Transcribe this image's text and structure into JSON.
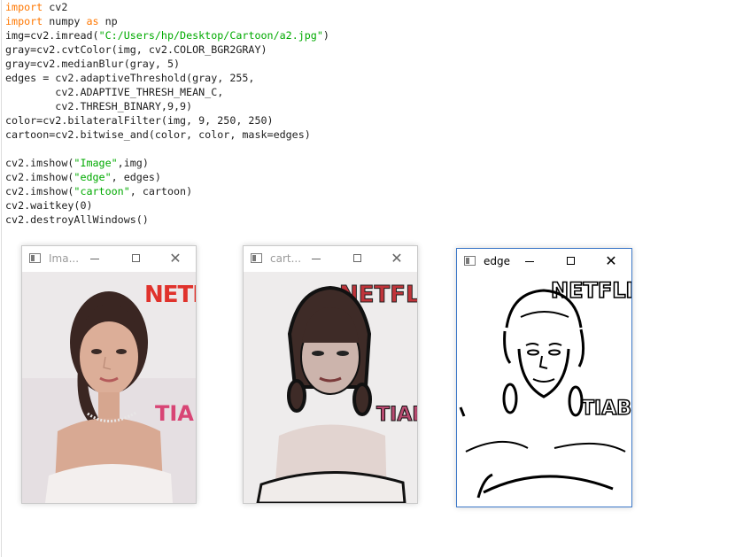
{
  "code": {
    "lines": [
      [
        {
          "t": "import",
          "c": "kw"
        },
        {
          "t": " cv2",
          "c": ""
        }
      ],
      [
        {
          "t": "import",
          "c": "kw"
        },
        {
          "t": " numpy ",
          "c": ""
        },
        {
          "t": "as",
          "c": "kw"
        },
        {
          "t": " np",
          "c": ""
        }
      ],
      [
        {
          "t": "img=cv2.imread(",
          "c": ""
        },
        {
          "t": "\"C:/Users/hp/Desktop/Cartoon/a2.jpg\"",
          "c": "str"
        },
        {
          "t": ")",
          "c": ""
        }
      ],
      [
        {
          "t": "gray=cv2.cvtColor(img, cv2.COLOR_BGR2GRAY)",
          "c": ""
        }
      ],
      [
        {
          "t": "gray=cv2.medianBlur(gray, 5)",
          "c": ""
        }
      ],
      [
        {
          "t": "edges = cv2.adaptiveThreshold(gray, 255,",
          "c": ""
        }
      ],
      [
        {
          "t": "        cv2.ADAPTIVE_THRESH_MEAN_C,",
          "c": ""
        }
      ],
      [
        {
          "t": "        cv2.THRESH_BINARY,9,9)",
          "c": ""
        }
      ],
      [
        {
          "t": "color=cv2.bilateralFilter(img, 9, 250, 250)",
          "c": ""
        }
      ],
      [
        {
          "t": "cartoon=cv2.bitwise_and(color, color, mask=edges)",
          "c": ""
        }
      ],
      [],
      [
        {
          "t": "cv2.imshow(",
          "c": ""
        },
        {
          "t": "\"Image\"",
          "c": "str"
        },
        {
          "t": ",img)",
          "c": ""
        }
      ],
      [
        {
          "t": "cv2.imshow(",
          "c": ""
        },
        {
          "t": "\"edge\"",
          "c": "str"
        },
        {
          "t": ", edges)",
          "c": ""
        }
      ],
      [
        {
          "t": "cv2.imshow(",
          "c": ""
        },
        {
          "t": "\"cartoon\"",
          "c": "str"
        },
        {
          "t": ", cartoon)",
          "c": ""
        }
      ],
      [
        {
          "t": "cv2.waitkey(0)",
          "c": ""
        }
      ],
      [
        {
          "t": "cv2.destroyAllWindows()",
          "c": ""
        }
      ]
    ]
  },
  "windows": {
    "image": {
      "title": "Ima...",
      "icon": "window-app-icon",
      "active": false
    },
    "cartoon": {
      "title": "cart...",
      "icon": "window-app-icon",
      "active": false
    },
    "edge": {
      "title": "edge",
      "icon": "window-app-icon",
      "active": true
    }
  },
  "controls": {
    "minimize": "minimize",
    "maximize": "maximize",
    "close": "close",
    "close_glyph": "✕"
  },
  "photo_text": {
    "netflix": "NETFLIX",
    "poster": "TIABL"
  },
  "colors": {
    "keyword": "#ff7700",
    "string": "#00aa00",
    "active_border": "#3c78c8"
  }
}
